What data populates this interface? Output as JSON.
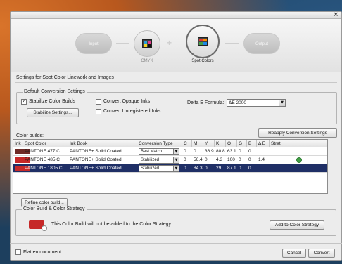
{
  "window": {
    "close_glyph": "×"
  },
  "wizard": {
    "steps": [
      {
        "label": "Input",
        "state": "inactive"
      },
      {
        "label": "CMYK",
        "state": "done"
      },
      {
        "label": "Spot Colors",
        "state": "active"
      },
      {
        "label": "Output",
        "state": "inactive"
      }
    ],
    "plus_glyph": "+"
  },
  "settings_title": "Settings for Spot Color Linework and Images",
  "conversion": {
    "group_title": "Default Conversion Settings",
    "stabilize_label": "Stabilize Color Builds",
    "stabilize_checked": true,
    "stabilize_settings_btn": "Stabilize Settings...",
    "opaque_label": "Convert Opaque Inks",
    "opaque_checked": false,
    "unregistered_label": "Convert Unregistered Inks",
    "unregistered_checked": false,
    "delta_label": "Delta E Formula:",
    "delta_value": "ΔE 2000"
  },
  "color_builds": {
    "label": "Color builds:",
    "reapply_btn": "Reapply Conversion Settings",
    "columns": [
      "Ink",
      "Spot Color",
      "Ink Book",
      "Conversion Type",
      "C",
      "M",
      "Y",
      "K",
      "O",
      "G",
      "B",
      "Δ E",
      "Strat."
    ],
    "rows": [
      {
        "swatch": "#6e2a26",
        "spot": "PANTONE 477 C",
        "book": "PANTONE+ Solid Coated",
        "type": "Best Match",
        "C": "0",
        "M": "0",
        "Y": "36.9",
        "K": "80.8",
        "O": "63.1",
        "G": "0",
        "B": "0",
        "dE": "",
        "strat": false,
        "selected": false
      },
      {
        "swatch": "#c62828",
        "spot": "PANTONE 485 C",
        "book": "PANTONE+ Solid Coated",
        "type": "Stabilized",
        "C": "0",
        "M": "56.4",
        "Y": "0",
        "K": "4.3",
        "O": "100",
        "G": "0",
        "B": "0",
        "dE": "1.4",
        "strat": true,
        "selected": false
      },
      {
        "swatch": "#c62a2a",
        "spot": "PANTONE 1805 C",
        "book": "PANTONE+ Solid Coated",
        "type": "Stabilized",
        "C": "0",
        "M": "84.3",
        "Y": "0",
        "K": "29",
        "O": "87.1",
        "G": "0",
        "B": "0",
        "dE": "",
        "strat": false,
        "selected": true
      }
    ],
    "refine_btn": "Refine color build..."
  },
  "strategy": {
    "group_title": "Color Build & Color Strategy",
    "message": "This Color Build will not be added to the Color Strategy",
    "add_btn": "Add to Color Strategy",
    "swatch": "#c62828"
  },
  "footer": {
    "flatten_label": "Flatten document",
    "flatten_checked": false,
    "cancel_btn": "Cancel",
    "convert_btn": "Convert"
  }
}
